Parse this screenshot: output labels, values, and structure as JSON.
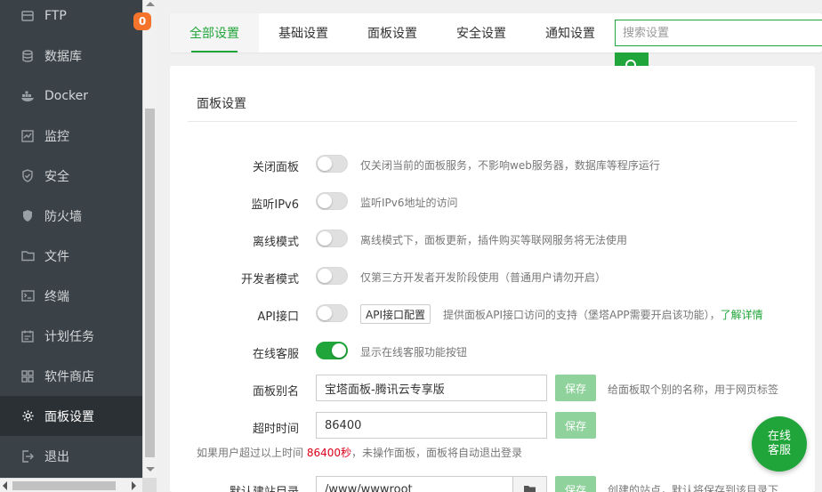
{
  "sidebar": {
    "items": [
      {
        "label": "FTP",
        "icon": "ftp-icon"
      },
      {
        "label": "数据库",
        "icon": "database-icon"
      },
      {
        "label": "Docker",
        "icon": "docker-icon"
      },
      {
        "label": "监控",
        "icon": "monitor-icon"
      },
      {
        "label": "安全",
        "icon": "shield-icon"
      },
      {
        "label": "防火墙",
        "icon": "firewall-icon"
      },
      {
        "label": "文件",
        "icon": "folder-icon"
      },
      {
        "label": "终端",
        "icon": "terminal-icon"
      },
      {
        "label": "计划任务",
        "icon": "calendar-icon"
      },
      {
        "label": "软件商店",
        "icon": "grid-icon"
      },
      {
        "label": "面板设置",
        "icon": "gear-icon"
      },
      {
        "label": "退出",
        "icon": "logout-icon"
      }
    ],
    "active_index": 10,
    "badge": "0"
  },
  "tabs": [
    {
      "label": "全部设置"
    },
    {
      "label": "基础设置"
    },
    {
      "label": "面板设置"
    },
    {
      "label": "安全设置"
    },
    {
      "label": "通知设置"
    }
  ],
  "search": {
    "placeholder": "搜索设置",
    "value": ""
  },
  "panel": {
    "title": "面板设置",
    "rows": {
      "close_panel": {
        "label": "关闭面板",
        "on": false,
        "desc": "仅关闭当前的面板服务，不影响web服务器，数据库等程序运行"
      },
      "ipv6": {
        "label": "监听IPv6",
        "on": false,
        "desc": "监听IPv6地址的访问"
      },
      "offline": {
        "label": "离线模式",
        "on": false,
        "desc": "离线模式下，面板更新，插件购买等联网服务将无法使用"
      },
      "developer": {
        "label": "开发者模式",
        "on": false,
        "desc": "仅第三方开发者开发阶段使用（普通用户请勿开启）"
      },
      "api": {
        "label": "API接口",
        "on": false,
        "config_btn": "API接口配置",
        "desc": "提供面板API接口访问的支持（堡塔APP需要开启该功能），",
        "link": "了解详情"
      },
      "online_service": {
        "label": "在线客服",
        "on": true,
        "desc": "显示在线客服功能按钮"
      },
      "alias": {
        "label": "面板别名",
        "value": "宝塔面板-腾讯云专享版",
        "save": "保存",
        "desc": "给面板取个别的名称，用于网页标签"
      },
      "timeout": {
        "label": "超时时间",
        "value": "86400",
        "save": "保存"
      },
      "timeout_note": {
        "prefix": "如果用户超过以上时间 ",
        "highlight": "86400秒",
        "suffix": "，未操作面板，面板将自动退出登录"
      },
      "site_dir": {
        "label": "默认建站目录",
        "value": "/www/wwwroot",
        "save": "保存",
        "desc": "创建的站点，默认将保存到该目录下"
      }
    }
  },
  "chat": {
    "line1": "在线",
    "line2": "客服"
  },
  "colors": {
    "accent": "#20a53a",
    "sidebar_bg": "#3b4247",
    "badge": "#f5732a",
    "highlight": "#d9001b"
  }
}
